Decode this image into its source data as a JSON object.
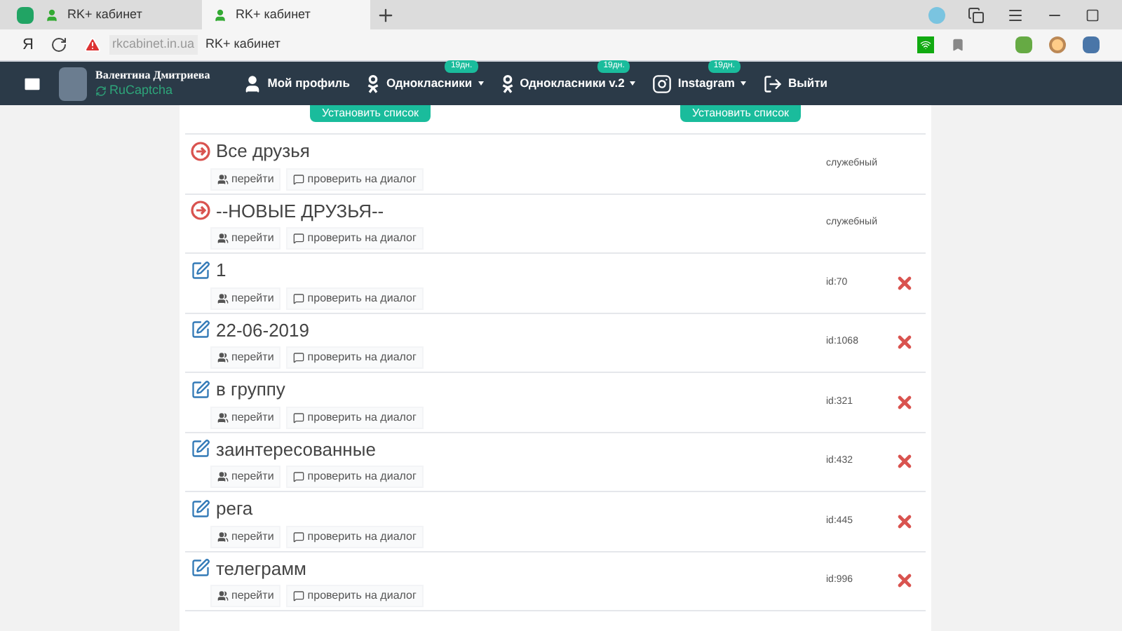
{
  "browser": {
    "tabs": [
      {
        "title": "RK+ кабинет",
        "selected": false
      },
      {
        "title": "RK+ кабинет",
        "selected": true
      }
    ],
    "address": {
      "domain": "rkcabinet.in.ua",
      "title": "RK+ кабинет"
    },
    "yandex_label": "Я"
  },
  "navbar": {
    "user_name": "Валентина Дмитриева",
    "service": "RuCaptcha",
    "items": [
      {
        "label": "Мой профиль",
        "kind": "profile",
        "dropdown": false
      },
      {
        "label": "Однокласники",
        "kind": "ok",
        "badge": "19дн.",
        "dropdown": true
      },
      {
        "label": "Однокласники v.2",
        "kind": "ok",
        "badge": "19дн.",
        "dropdown": true
      },
      {
        "label": "Instagram",
        "kind": "instagram",
        "badge": "19дн.",
        "dropdown": true
      },
      {
        "label": "Выйти",
        "kind": "logout",
        "dropdown": false
      }
    ]
  },
  "set_list_buttons": [
    "Установить список",
    "Установить список"
  ],
  "lists": [
    {
      "kind": "service",
      "name": "Все друзья",
      "tag": "служебный",
      "go": "перейти",
      "check": "проверить на диалог"
    },
    {
      "kind": "service",
      "name": "--НОВЫЕ ДРУЗЬЯ--",
      "tag": "служебный",
      "go": "перейти",
      "check": "проверить на диалог"
    },
    {
      "kind": "user",
      "name": "1",
      "tag": "id:70",
      "go": "перейти",
      "check": "проверить на диалог"
    },
    {
      "kind": "user",
      "name": "22-06-2019",
      "tag": "id:1068",
      "go": "перейти",
      "check": "проверить на диалог"
    },
    {
      "kind": "user",
      "name": "в группу",
      "tag": "id:321",
      "go": "перейти",
      "check": "проверить на диалог"
    },
    {
      "kind": "user",
      "name": "заинтересованные",
      "tag": "id:432",
      "go": "перейти",
      "check": "проверить на диалог"
    },
    {
      "kind": "user",
      "name": "рега",
      "tag": "id:445",
      "go": "перейти",
      "check": "проверить на диалог"
    },
    {
      "kind": "user",
      "name": "телеграмм",
      "tag": "id:996",
      "go": "перейти",
      "check": "проверить на диалог"
    }
  ]
}
